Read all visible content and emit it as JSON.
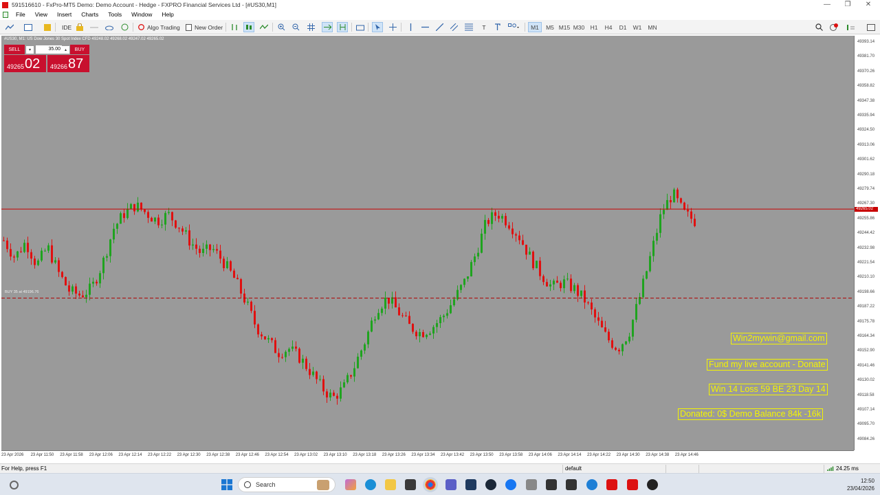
{
  "window": {
    "title": "591516610 - FxPro-MT5 Demo: Demo Account - Hedge - FXPRO Financial Services Ltd - [#US30,M1]",
    "controls": [
      "—",
      "❐",
      "✕"
    ]
  },
  "menu": [
    "File",
    "View",
    "Insert",
    "Charts",
    "Tools",
    "Window",
    "Help"
  ],
  "toolbar": {
    "ide_label": "IDE",
    "algo_label": "Algo Trading",
    "new_order_label": "New Order",
    "timeframes": [
      "M1",
      "M5",
      "M15",
      "M30",
      "H1",
      "H4",
      "D1",
      "W1",
      "MN"
    ],
    "active_timeframe": "M1"
  },
  "chart": {
    "symbol_line": "#US30, M1: US Dow Jones 30 Spot Index CFD  49248.02 49268.02 49247.02 49265.02",
    "one_click": {
      "sell_label": "SELL",
      "buy_label": "BUY",
      "volume": "35.00",
      "bid_small": "49265",
      "bid_big": "02",
      "ask_small": "49266",
      "ask_big": "87"
    },
    "buy_line_label": "BUY 35 at 49196.76",
    "info_boxes": [
      "Win2mywin@gmail.com",
      "Fund my live account - Donate",
      "Win 14  Loss 59  BE 23  Day 14",
      "Donated: 0$  Demo Balance 84k -16k"
    ],
    "price_tag": "49265.02",
    "colors": {
      "background": "#9a9a9a",
      "bull": "#1fa31f",
      "bear": "#e01010",
      "text": "#f4f400",
      "bid_line": "#c80000"
    }
  },
  "chart_data": {
    "type": "candlestick",
    "symbol": "#US30",
    "timeframe": "M1",
    "y_ticks": [
      "49393.14",
      "49381.70",
      "49370.26",
      "49358.82",
      "49347.38",
      "49335.94",
      "49324.50",
      "49313.06",
      "49301.62",
      "49290.18",
      "49279.74",
      "49267.30",
      "49255.86",
      "49244.42",
      "49232.98",
      "49221.54",
      "49210.10",
      "49198.66",
      "49187.22",
      "49175.78",
      "49164.34",
      "49152.90",
      "49141.46",
      "49130.02",
      "49118.58",
      "49107.14",
      "49095.70",
      "49084.26"
    ],
    "x_ticks": [
      "23 Apr 2026",
      "23 Apr 11:50",
      "23 Apr 11:58",
      "23 Apr 12:06",
      "23 Apr 12:14",
      "23 Apr 12:22",
      "23 Apr 12:30",
      "23 Apr 12:38",
      "23 Apr 12:46",
      "23 Apr 12:54",
      "23 Apr 13:02",
      "23 Apr 13:10",
      "23 Apr 13:18",
      "23 Apr 13:26",
      "23 Apr 13:34",
      "23 Apr 13:42",
      "23 Apr 13:50",
      "23 Apr 13:58",
      "23 Apr 14:06",
      "23 Apr 14:14",
      "23 Apr 14:22",
      "23 Apr 14:30",
      "23 Apr 14:38",
      "23 Apr 14:46"
    ],
    "ylim": [
      49080,
      49398
    ],
    "current_price": 49265.02,
    "buy_entry": 49196.76,
    "close_path": [
      49241,
      49228,
      49240,
      49222,
      49236,
      49216,
      49202,
      49199,
      49204,
      49223,
      49250,
      49262,
      49268,
      49262,
      49256,
      49261,
      49252,
      49240,
      49231,
      49235,
      49225,
      49212,
      49195,
      49175,
      49165,
      49155,
      49158,
      49151,
      49140,
      49128,
      49120,
      49128,
      49145,
      49165,
      49189,
      49197,
      49186,
      49175,
      49170,
      49174,
      49182,
      49195,
      49209,
      49230,
      49255,
      49262,
      49255,
      49244,
      49228,
      49215,
      49205,
      49209,
      49204,
      49195,
      49180,
      49166,
      49158,
      49170,
      49198,
      49230,
      49263,
      49277,
      49262,
      49256
    ]
  },
  "statusbar": {
    "help": "For Help, press F1",
    "profile": "default",
    "ping": "24.25 ms"
  },
  "taskbar": {
    "search_label": "Search",
    "time": "12:50",
    "date": "23/04/2026"
  }
}
